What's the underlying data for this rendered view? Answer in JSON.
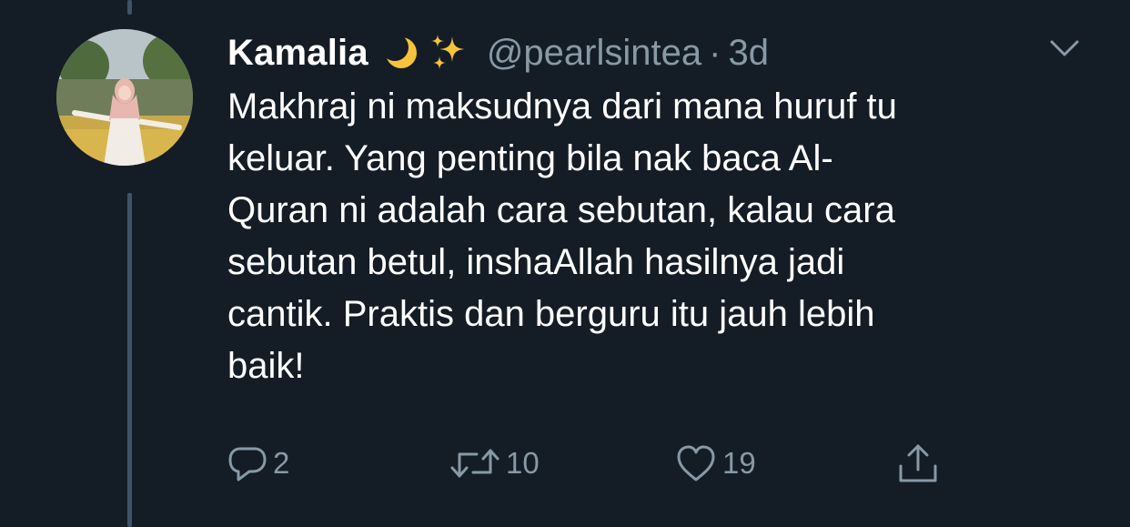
{
  "tweet": {
    "display_name": "Kamalia",
    "name_emoji": [
      "crescent-moon-icon",
      "sparkles-icon"
    ],
    "handle": "@pearlsintea",
    "separator": "·",
    "time": "3d",
    "text": "Makhraj ni maksudnya dari mana huruf tu keluar. Yang penting bila nak baca Al-Quran ni adalah cara sebutan, kalau cara sebutan betul, insha Allah hasilnya jadi cantik. Praktis dan berguru itu jauh lebih baik!",
    "text_lines": [
      "Makhraj ni maksudnya dari mana huruf tu",
      "keluar. Yang penting bila nak baca Al-",
      "Quran ni adalah cara sebutan, kalau cara",
      "sebutan betul, inshaAllah hasilnya jadi",
      "cantik. Praktis dan berguru itu jauh lebih",
      "baik!"
    ]
  },
  "actions": {
    "reply": {
      "icon": "reply-icon",
      "count": "2"
    },
    "retweet": {
      "icon": "retweet-icon",
      "count": "10"
    },
    "like": {
      "icon": "heart-icon",
      "count": "19"
    },
    "share": {
      "icon": "share-icon"
    }
  },
  "colors": {
    "background": "#141d26",
    "primary_text": "#ffffff",
    "secondary_text": "#8899a6",
    "thread_line": "#3d5466"
  }
}
